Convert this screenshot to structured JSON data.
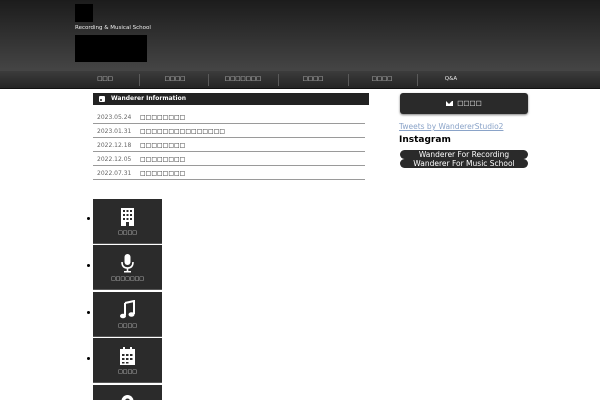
{
  "header": {
    "tagline": "Recording & Musical School"
  },
  "nav": {
    "items": [
      "□□□",
      "□□□□",
      "□□□□□□□",
      "□□□□",
      "□□□□",
      "Q&A"
    ]
  },
  "info": {
    "title": "Wanderer Information",
    "news": [
      {
        "date": "2023.05.24",
        "title": "□□□□□□□□"
      },
      {
        "date": "2023.01.31",
        "title": "□□□□□□□□□□□□□□□"
      },
      {
        "date": "2022.12.18",
        "title": "□□□□□□□□"
      },
      {
        "date": "2022.12.05",
        "title": "□□□□□□□□"
      },
      {
        "date": "2022.07.31",
        "title": "□□□□□□□□"
      }
    ]
  },
  "sidebar": {
    "contact_label": "□□□□",
    "tweets_link": "Tweets by WandererStudio2",
    "instagram_title": "Instagram",
    "instagram_links": [
      "Wanderer For Recording",
      "Wanderer For Music School"
    ]
  },
  "menu": {
    "items": [
      {
        "label": "□□□□",
        "icon": "building-icon"
      },
      {
        "label": "□□□□□□□",
        "icon": "microphone-icon"
      },
      {
        "label": "□□□□",
        "icon": "music-note-icon"
      },
      {
        "label": "□□□□",
        "icon": "calendar-icon"
      }
    ]
  }
}
